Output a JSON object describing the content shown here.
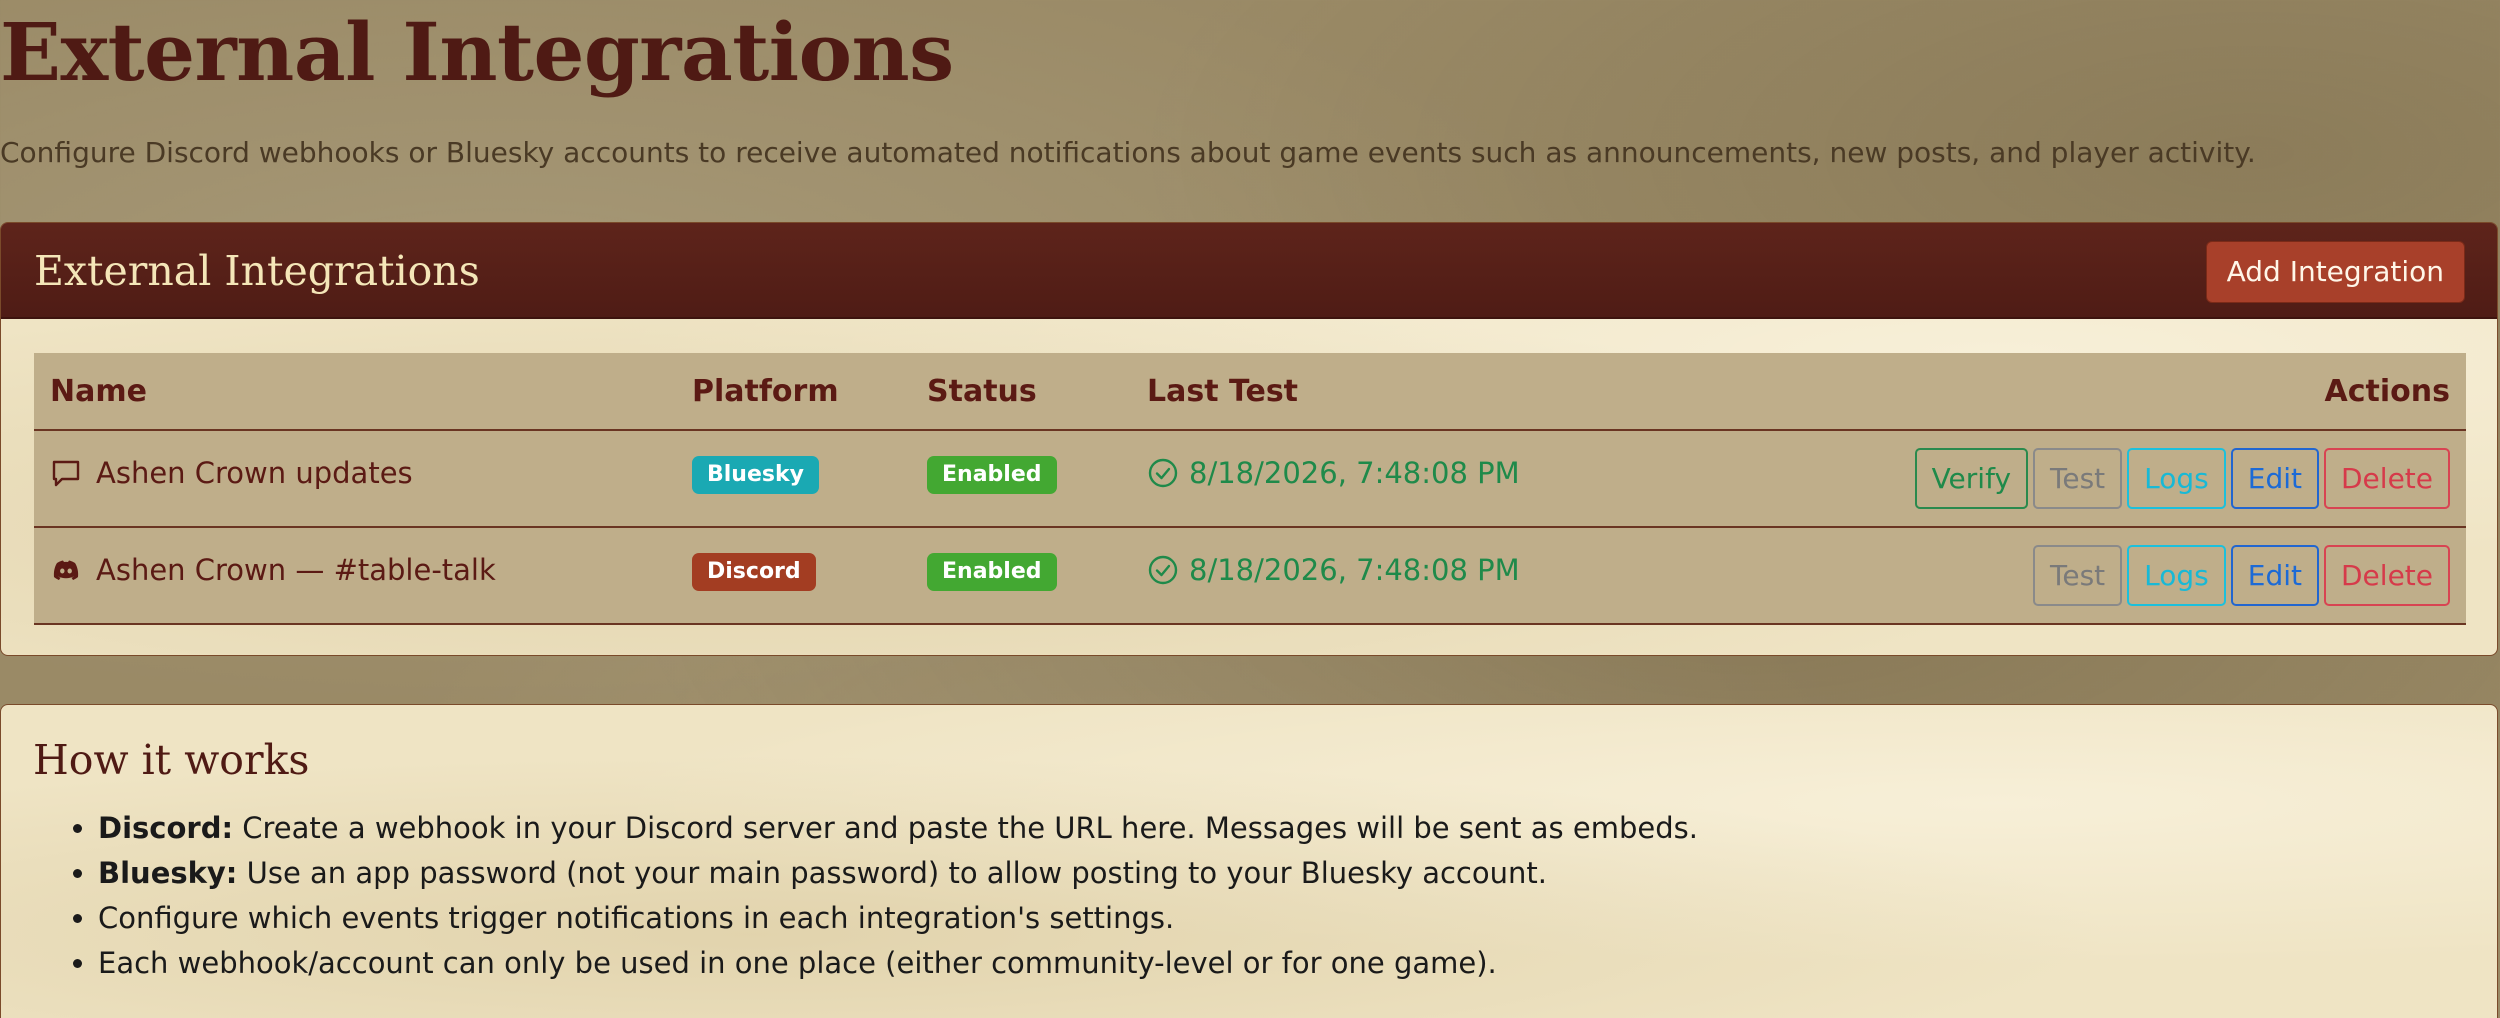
{
  "page": {
    "title": "External Integrations",
    "description": "Configure Discord webhooks or Bluesky accounts to receive automated notifications about game events such as announcements, new posts, and player activity."
  },
  "integrations_card": {
    "title": "External Integrations",
    "add_button_label": "Add Integration",
    "columns": {
      "name": "Name",
      "platform": "Platform",
      "status": "Status",
      "last_test": "Last Test",
      "actions": "Actions"
    },
    "rows": [
      {
        "name": "Ashen Crown updates",
        "icon": "chat-bubble-icon",
        "platform": "Bluesky",
        "status": "Enabled",
        "last_test": "8/18/2026, 7:48:08 PM",
        "actions": {
          "verify": "Verify",
          "test": "Test",
          "logs": "Logs",
          "edit": "Edit",
          "delete": "Delete"
        }
      },
      {
        "name": "Ashen Crown — #table-talk",
        "icon": "discord-icon",
        "platform": "Discord",
        "status": "Enabled",
        "last_test": "8/18/2026, 7:48:08 PM",
        "actions": {
          "test": "Test",
          "logs": "Logs",
          "edit": "Edit",
          "delete": "Delete"
        }
      }
    ]
  },
  "how_it_works": {
    "title": "How it works",
    "items": [
      {
        "label": "Discord:",
        "text": " Create a webhook in your Discord server and paste the URL here. Messages will be sent as embeds."
      },
      {
        "label": "Bluesky:",
        "text": " Use an app password (not your main password) to allow posting to your Bluesky account."
      },
      {
        "label": "",
        "text": "Configure which events trigger notifications in each integration's settings."
      },
      {
        "label": "",
        "text": "Each webhook/account can only be used in one place (either community-level or for one game)."
      }
    ]
  },
  "colors": {
    "header_bg": "#5a2119",
    "accent_button": "#a8402a",
    "badge_bluesky": "#1aa9b3",
    "badge_discord": "#a33d22",
    "badge_enabled": "#43a832",
    "success_text": "#1f8a4a"
  }
}
